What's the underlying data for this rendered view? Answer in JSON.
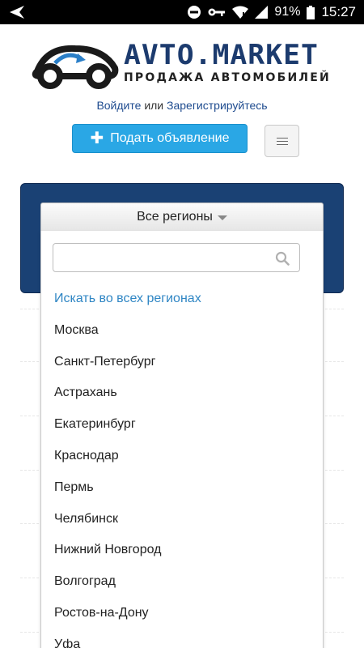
{
  "statusbar": {
    "battery": "91%",
    "time": "15:27",
    "icons": [
      "back-arrow-icon",
      "do-not-disturb-icon",
      "key-icon",
      "wifi-icon",
      "signal-icon",
      "battery-icon"
    ]
  },
  "logo": {
    "title": "AVTO.MARKET",
    "subtitle": "ПРОДАЖА АВТОМОБИЛЕЙ"
  },
  "auth": {
    "login": "Войдите",
    "or": "или",
    "register": "Зарегистрируйтесь"
  },
  "post_button": {
    "icon": "plus-icon",
    "label": "Подать объявление",
    "color": "#2aa7e5"
  },
  "menu_button": {
    "icon": "hamburger-icon"
  },
  "region_dropdown": {
    "selected": "Все регионы",
    "search_value": "",
    "panel_color": "#1a4174",
    "options": [
      "Искать во всех регионах",
      "Москва",
      "Санкт-Петербург",
      "Астрахань",
      "Екатеринбург",
      "Краснодар",
      "Пермь",
      "Челябинск",
      "Нижний Новгород",
      "Волгоград",
      "Ростов-на-Дону",
      "Уфа"
    ]
  }
}
